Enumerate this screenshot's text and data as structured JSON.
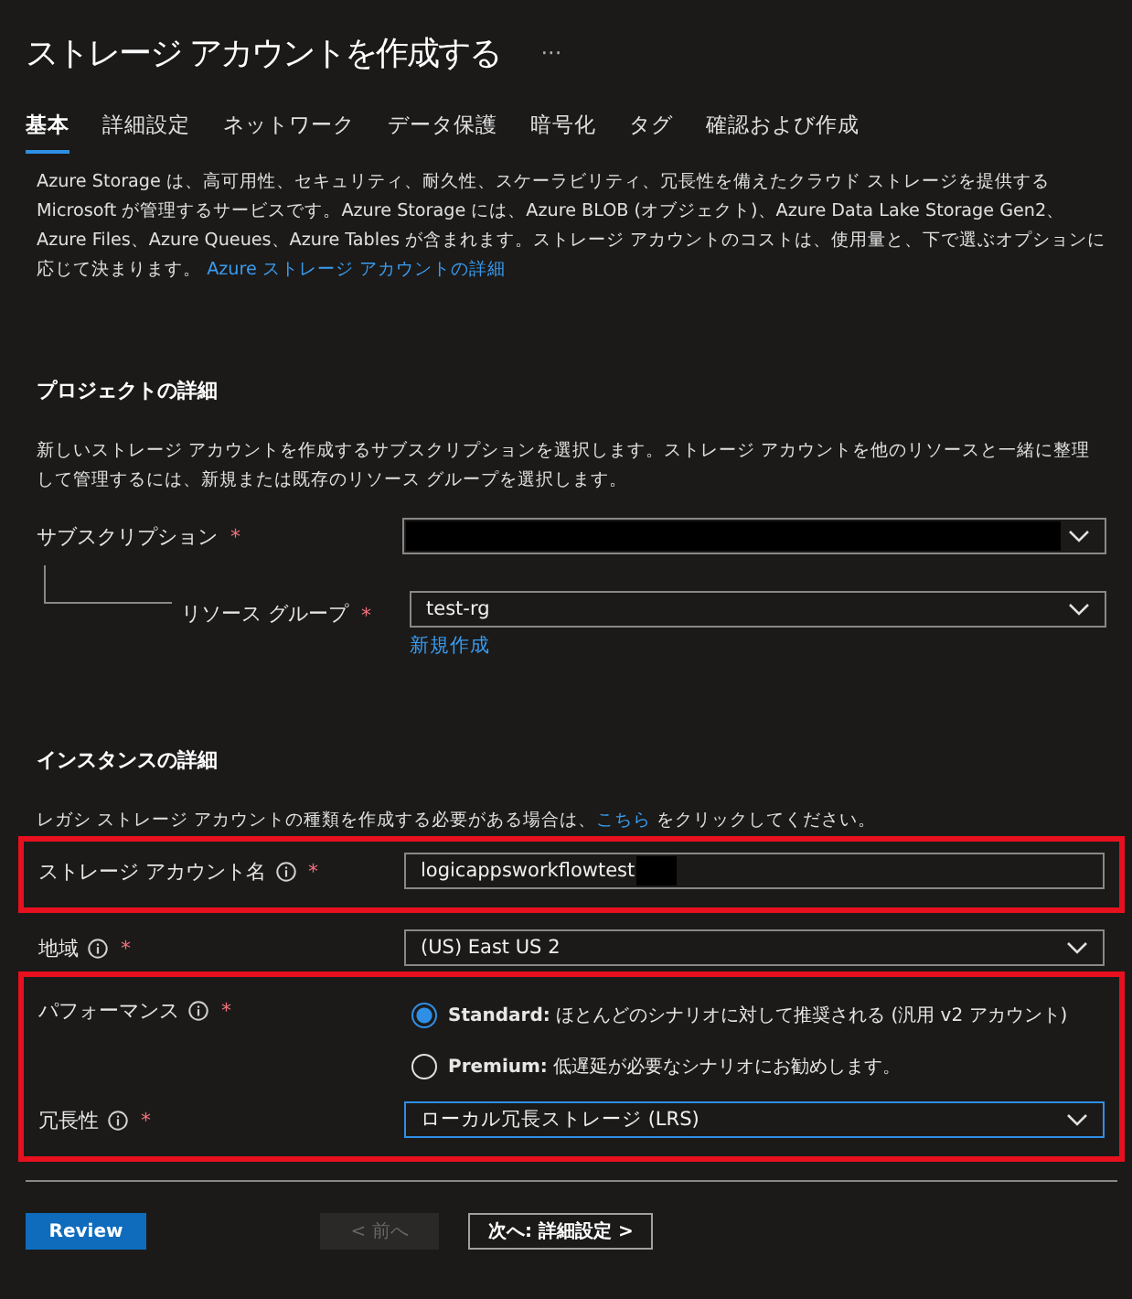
{
  "title": "ストレージ アカウントを作成する",
  "more": "···",
  "tabs": [
    {
      "label": "基本",
      "selected": true
    },
    {
      "label": "詳細設定",
      "selected": false
    },
    {
      "label": "ネットワーク",
      "selected": false
    },
    {
      "label": "データ保護",
      "selected": false
    },
    {
      "label": "暗号化",
      "selected": false
    },
    {
      "label": "タグ",
      "selected": false
    },
    {
      "label": "確認および作成",
      "selected": false
    }
  ],
  "intro": {
    "text": "Azure Storage は、高可用性、セキュリティ、耐久性、スケーラビリティ、冗長性を備えたクラウド ストレージを提供する Microsoft が管理するサービスです。Azure Storage には、Azure BLOB (オブジェクト)、Azure Data Lake Storage Gen2、Azure Files、Azure Queues、Azure Tables が含まれます。ストレージ アカウントのコストは、使用量と、下で選ぶオプションに応じて決まります。",
    "link": "Azure ストレージ アカウントの詳細"
  },
  "project": {
    "heading": "プロジェクトの詳細",
    "text": "新しいストレージ アカウントを作成するサブスクリプションを選択します。ストレージ アカウントを他のリソースと一緒に整理して管理するには、新規または既存のリソース グループを選択します。",
    "fields": [
      {
        "kind": "select",
        "label": "サブスクリプション",
        "required": "*",
        "info": false,
        "nested": false,
        "redacted": true,
        "focused": false
      },
      {
        "kind": "select",
        "label": "リソース グループ",
        "required": "*",
        "info": false,
        "nested": true,
        "value": "test-rg",
        "link": "新規作成",
        "redacted": false,
        "focused": false
      }
    ]
  },
  "instance": {
    "heading": "インスタンスの詳細",
    "note_before": "レガシ ストレージ アカウントの種類を作成する必要がある場合は、",
    "note_link": "こちら",
    "note_after": " をクリックしてください。",
    "groups": [
      {
        "highlighted": true,
        "fields": [
          {
            "kind": "text",
            "label": "ストレージ アカウント名",
            "required": "*",
            "info": true,
            "value": "logicappsworkflowtest",
            "redacted": true,
            "focused": false
          }
        ]
      },
      {
        "highlighted": false,
        "fields": [
          {
            "kind": "select",
            "label": "地域",
            "required": "*",
            "info": true,
            "value": "(US) East US 2",
            "redacted": false,
            "focused": false
          }
        ]
      },
      {
        "highlighted": true,
        "fields": [
          {
            "kind": "radio",
            "label": "パフォーマンス",
            "required": "*",
            "info": true,
            "options": [
              {
                "name": "Standard:",
                "text": "ほとんどのシナリオに対して推奨される (汎用 v2 アカウント)",
                "selected": true
              },
              {
                "name": "Premium:",
                "text": "低遅延が必要なシナリオにお勧めします。",
                "selected": false
              }
            ]
          },
          {
            "kind": "select",
            "label": "冗長性",
            "required": "*",
            "info": true,
            "value": "ローカル冗長ストレージ (LRS)",
            "redacted": false,
            "focused": true
          }
        ]
      }
    ]
  },
  "footer": [
    {
      "kind": "primary",
      "label": "Review",
      "disabled": false
    },
    {
      "kind": "secondary",
      "label": "< 前へ",
      "disabled": true
    },
    {
      "kind": "secondary",
      "label": "次へ: 詳細設定 >",
      "disabled": false
    }
  ]
}
